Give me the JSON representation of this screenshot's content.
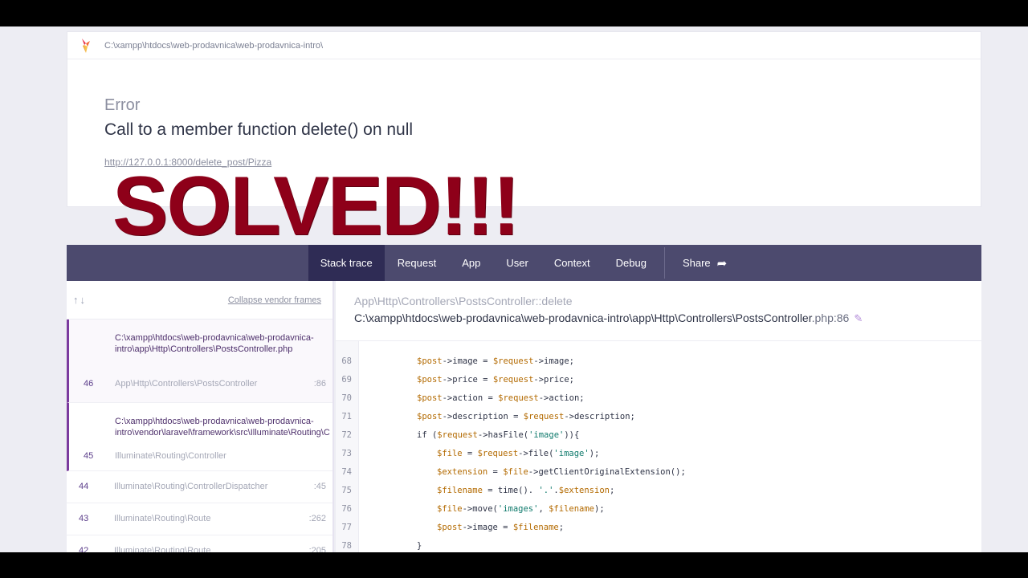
{
  "header": {
    "path": "C:\\xampp\\htdocs\\web-prodavnica\\web-prodavnica-intro\\",
    "error_label": "Error",
    "error_message": "Call to a member function delete() on null",
    "url": "http://127.0.0.1:8000/delete_post/Pizza"
  },
  "overlay": {
    "text": "SOLVED!!!",
    "color": "#8e0019"
  },
  "tabs": [
    {
      "label": "Stack trace",
      "active": true
    },
    {
      "label": "Request"
    },
    {
      "label": "App"
    },
    {
      "label": "User"
    },
    {
      "label": "Context"
    },
    {
      "label": "Debug"
    }
  ],
  "share": {
    "label": "Share",
    "icon": "share-arrow-icon"
  },
  "frames_panel": {
    "arrows": "↑↓",
    "collapse_label": "Collapse vendor frames",
    "frames": [
      {
        "number": "46",
        "file": "C:\\xampp\\htdocs\\web-prodavnica\\web-prodavnica-intro\\app\\Http\\Controllers\\PostsController.php",
        "class": "App\\Http\\Controllers\\PostsController",
        "line": ":86"
      },
      {
        "number": "45",
        "file": "C:\\xampp\\htdocs\\web-prodavnica\\web-prodavnica-intro\\vendor\\laravel\\framework\\src\\Illuminate\\Routing\\Controller.php",
        "class": "Illuminate\\Routing\\Controller",
        "line": ""
      },
      {
        "number": "44",
        "class": "Illuminate\\Routing\\ControllerDispatcher",
        "line": ":45"
      },
      {
        "number": "43",
        "class": "Illuminate\\Routing\\Route",
        "line": ":262"
      },
      {
        "number": "42",
        "class": "Illuminate\\Routing\\Route",
        "line": ":205"
      }
    ]
  },
  "code_panel": {
    "class_method": "App\\Http\\Controllers\\PostsController::delete",
    "file_path": "C:\\xampp\\htdocs\\web-prodavnica\\web-prodavnica-intro\\app\\Http\\Controllers\\PostsController",
    "file_ext": ".php:86",
    "lines": [
      {
        "n": "68",
        "code": "$post->image = $request->image;"
      },
      {
        "n": "69",
        "code": "$post->price = $request->price;"
      },
      {
        "n": "70",
        "code": "$post->action = $request->action;"
      },
      {
        "n": "71",
        "code": "$post->description = $request->description;"
      },
      {
        "n": "72",
        "code": "if ($request->hasFile('image')){"
      },
      {
        "n": "73",
        "code": "$file = $request->file('image');"
      },
      {
        "n": "74",
        "code": "$extension = $file->getClientOriginalExtension();"
      },
      {
        "n": "75",
        "code": "$filename = time(). '.'.$extension;"
      },
      {
        "n": "76",
        "code": "$file->move('images', $filename);"
      },
      {
        "n": "77",
        "code": "$post->image = $filename;"
      },
      {
        "n": "78",
        "code": "}"
      }
    ]
  },
  "colors": {
    "accent": "#7b3b9e",
    "tabbar": "#4c4a6e",
    "tab_active": "#2f2c55"
  }
}
